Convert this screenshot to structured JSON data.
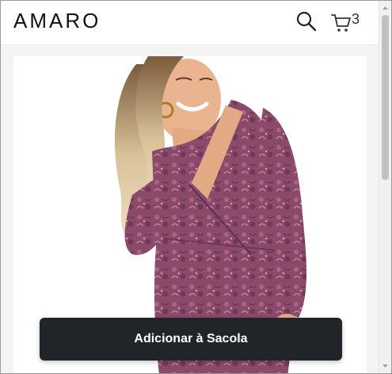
{
  "header": {
    "logo_text": "AMARO",
    "search_icon": "search-icon",
    "cart_icon": "cart-icon",
    "cart_count": "3"
  },
  "product": {
    "image_alt": "model wearing long-sleeve paisley wrap dress",
    "dress_color": "#8c4a6a",
    "add_to_bag_label": "Adicionar à Sacola"
  },
  "colors": {
    "button_bg": "#212428",
    "page_bg": "#f4f4f4"
  }
}
